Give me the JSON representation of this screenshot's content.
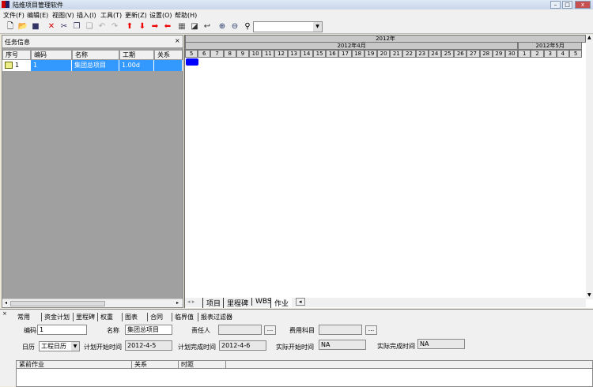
{
  "window": {
    "title": "陆维项目管理软件"
  },
  "menu": [
    "文件(F)",
    "编辑(E)",
    "视图(V)",
    "插入(I)",
    "工具(T)",
    "更新(Z)",
    "设置(O)",
    "帮助(H)"
  ],
  "toolbar_icons": [
    "new-icon",
    "open-icon",
    "save-icon",
    "delete-icon",
    "cut-icon",
    "copy-icon",
    "paste-icon",
    "undo-icon",
    "redo-icon",
    "arrow-up-icon",
    "arrow-down-icon",
    "arrow-right-icon",
    "arrow-left-icon",
    "grid-icon",
    "properties-icon",
    "link-icon",
    "zoom-in-icon",
    "zoom-out-icon",
    "find-icon"
  ],
  "task_panel": {
    "title": "任务信息",
    "close": "×",
    "columns": [
      "序号",
      "编码",
      "名称",
      "工期",
      "关系"
    ],
    "rows": [
      {
        "seq": "1",
        "code": "1",
        "name": "集团总项目",
        "duration": "1.00d",
        "relation": ""
      }
    ]
  },
  "gantt": {
    "year": "2012年",
    "months": [
      {
        "label": "2012年4月",
        "days": [
          "5",
          "6",
          "7",
          "8",
          "9",
          "10",
          "11",
          "12",
          "13",
          "14",
          "15",
          "16",
          "17",
          "18",
          "19",
          "20",
          "21",
          "22",
          "23",
          "24",
          "25",
          "26",
          "27",
          "28",
          "29",
          "30"
        ]
      },
      {
        "label": "2012年5月",
        "days": [
          "1",
          "2",
          "3",
          "4",
          "5"
        ]
      }
    ],
    "bar_color": "#0000ff"
  },
  "sheet_tabs": [
    "项目",
    "里程碑",
    "WBS",
    "作业"
  ],
  "detail": {
    "tabs": [
      "常用",
      "资金计划",
      "里程碑",
      "权重",
      "图表",
      "合同",
      "临界值",
      "报表过滤器"
    ],
    "code_label": "编码",
    "code": "1",
    "name_label": "名称",
    "name": "集团总项目",
    "owner_label": "责任人",
    "owner": "",
    "cost_label": "费用科目",
    "cost": "",
    "ellipsis": "...",
    "calendar_label": "日历",
    "calendar": "工程日历",
    "plan_start_label": "计划开始时间",
    "plan_start": "2012-4-5",
    "plan_end_label": "计划完成时间",
    "plan_end": "2012-4-6",
    "act_start_label": "实际开始时间",
    "act_start": "NA",
    "act_end_label": "实际完成时间",
    "act_end": "NA",
    "pred_columns": [
      "紧前作业",
      "关系",
      "时距"
    ]
  }
}
